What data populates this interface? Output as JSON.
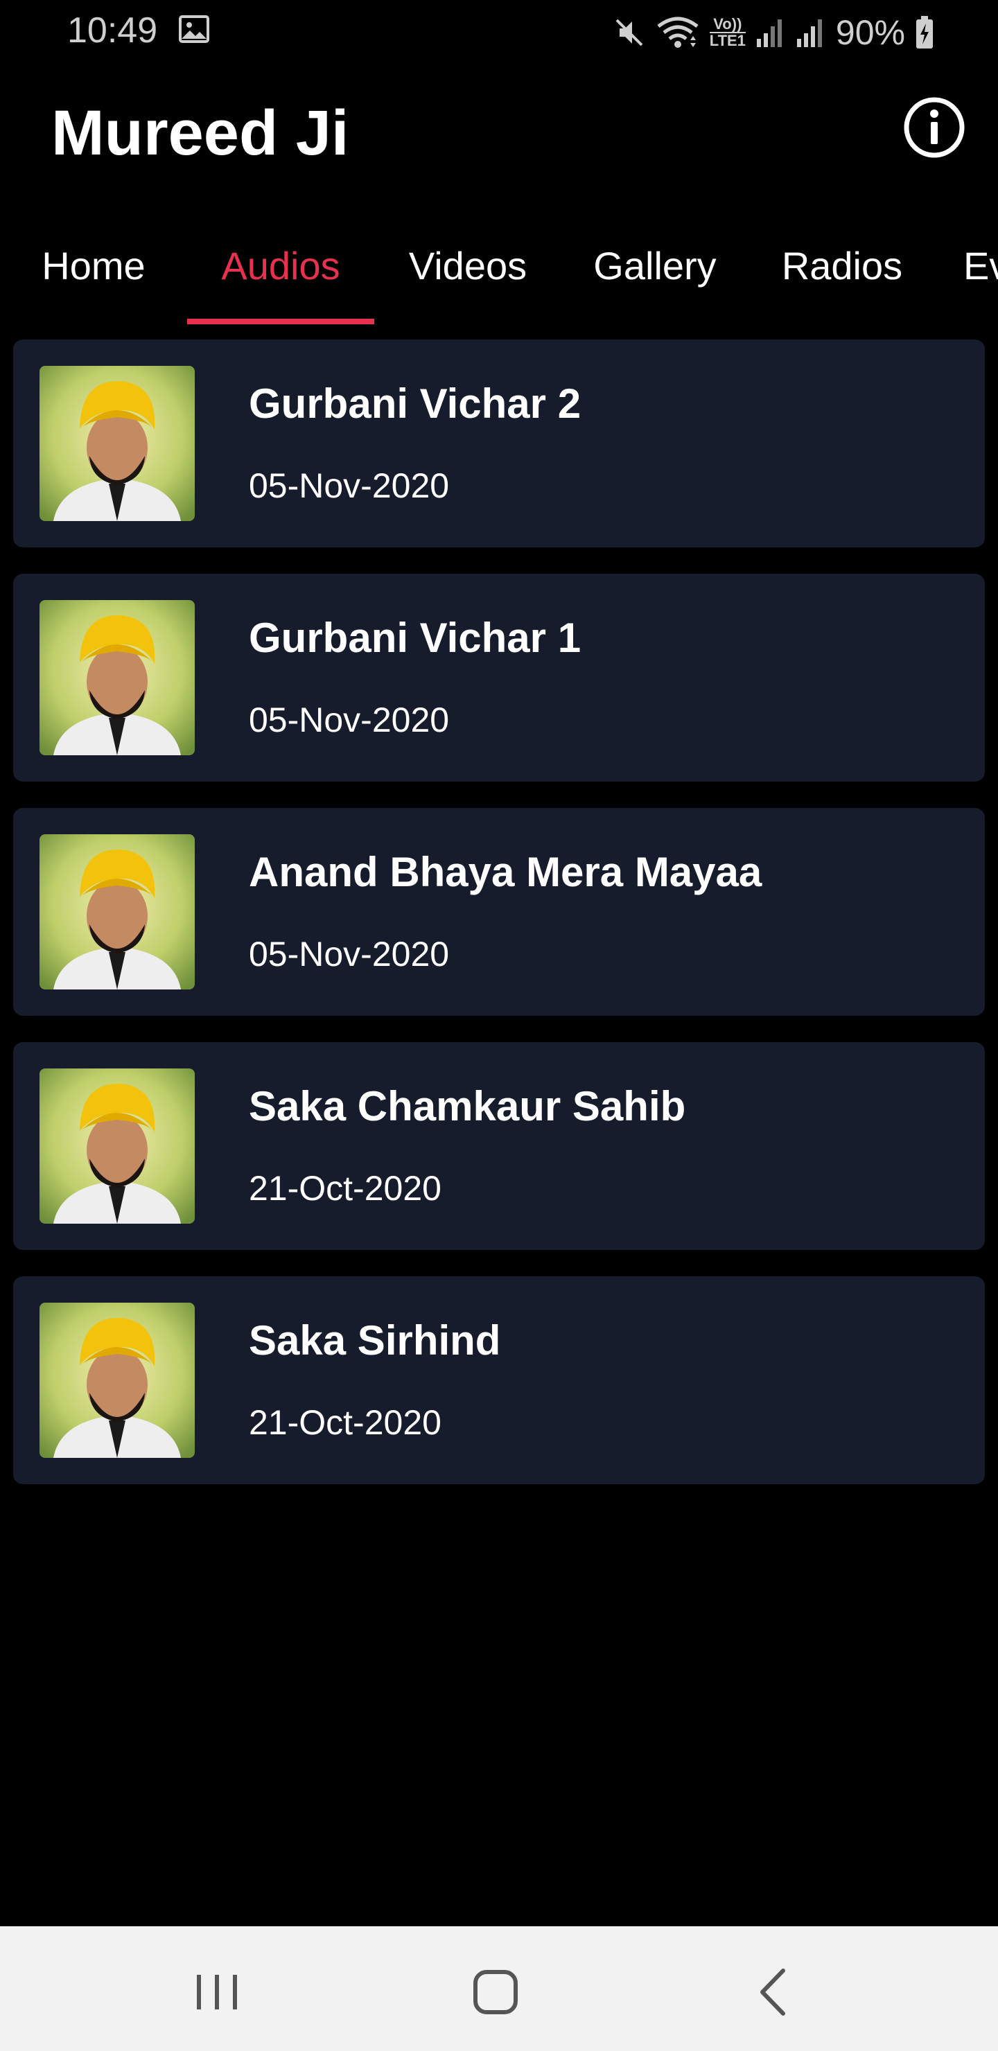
{
  "status_bar": {
    "time": "10:49",
    "battery": "90%",
    "icons": [
      "gallery-icon",
      "mute-icon",
      "wifi-icon",
      "volte-icon",
      "signal-icon",
      "signal-icon",
      "battery-charging-icon"
    ],
    "network_label_top": "Vo))",
    "network_label_bottom": "LTE1"
  },
  "app_bar": {
    "title": "Mureed Ji",
    "info_icon": "info-icon"
  },
  "tabs": [
    {
      "label": "Home",
      "active": false
    },
    {
      "label": "Audios",
      "active": true
    },
    {
      "label": "Videos",
      "active": false
    },
    {
      "label": "Gallery",
      "active": false
    },
    {
      "label": "Radios",
      "active": false
    },
    {
      "label": "Ev",
      "active": false
    }
  ],
  "audios": [
    {
      "title": "Gurbani Vichar 2",
      "date": "05-Nov-2020"
    },
    {
      "title": "Gurbani Vichar 1",
      "date": "05-Nov-2020"
    },
    {
      "title": "Anand Bhaya Mera Mayaa",
      "date": "05-Nov-2020"
    },
    {
      "title": "Saka Chamkaur Sahib",
      "date": "21-Oct-2020"
    },
    {
      "title": "Saka Sirhind",
      "date": "21-Oct-2020"
    }
  ],
  "nav_bar": {
    "recents_icon": "recents-icon",
    "home_icon": "home-icon",
    "back_icon": "back-icon"
  },
  "colors": {
    "background": "#000000",
    "accent": "#e8304f",
    "card": "#171c2c",
    "nav_bar": "#f2f2f2"
  }
}
